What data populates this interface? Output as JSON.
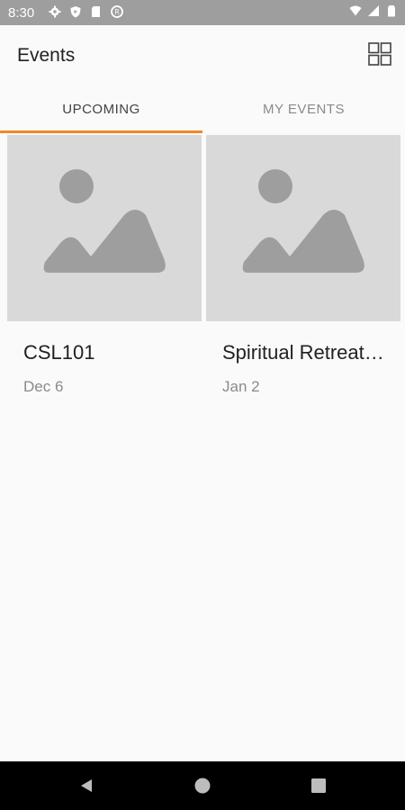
{
  "status_bar": {
    "time": "8:30",
    "left_icons": [
      "settings-icon",
      "shield-icon",
      "sim-card-icon",
      "data-saver-icon"
    ],
    "right_icons": [
      "wifi-icon",
      "signal-icon",
      "battery-icon"
    ]
  },
  "app_bar": {
    "title": "Events",
    "action_icon": "grid-view-icon"
  },
  "tabs": [
    {
      "label": "UPCOMING",
      "active": true
    },
    {
      "label": "MY EVENTS",
      "active": false
    }
  ],
  "events": [
    {
      "title": "CSL101",
      "date": "Dec 6",
      "image": "image-placeholder-icon"
    },
    {
      "title": "Spiritual Retreat…",
      "date": "Jan 2",
      "image": "image-placeholder-icon"
    }
  ],
  "nav_bar": {
    "buttons": [
      "back-icon",
      "home-icon",
      "recents-icon"
    ]
  },
  "colors": {
    "accent": "#f08a24",
    "status_bar": "#9e9e9e",
    "background": "#fafafa",
    "placeholder": "#d9d9d9",
    "placeholder_art": "#9e9e9e"
  }
}
